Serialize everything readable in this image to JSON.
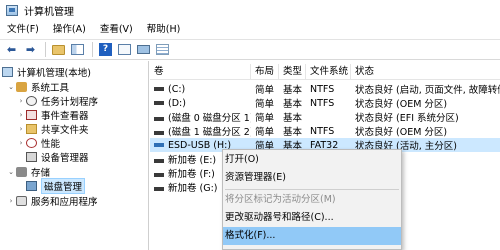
{
  "window": {
    "title": "计算机管理",
    "icon": "computer-management-icon"
  },
  "menu": [
    "文件(F)",
    "操作(A)",
    "查看(V)",
    "帮助(H)"
  ],
  "toolbar": {
    "icons": [
      "back-arrow-icon",
      "forward-arrow-icon",
      "up-folder-icon",
      "show-hide-tree-icon",
      "help-icon",
      "properties-icon",
      "connect-icon",
      "list-icon"
    ],
    "back_glyph": "⬅",
    "forward_glyph": "➡",
    "help_glyph": "?"
  },
  "tree": {
    "items": [
      {
        "label": "计算机管理(本地)",
        "icon": "computer-icon"
      },
      {
        "label": "系统工具",
        "icon": "tools-icon",
        "expand": "⌄"
      },
      {
        "label": "任务计划程序",
        "icon": "task-scheduler-icon",
        "expand": "›"
      },
      {
        "label": "事件查看器",
        "icon": "event-viewer-icon",
        "expand": "›"
      },
      {
        "label": "共享文件夹",
        "icon": "shared-folder-icon",
        "expand": "›"
      },
      {
        "label": "性能",
        "icon": "performance-icon",
        "expand": "›"
      },
      {
        "label": "设备管理器",
        "icon": "device-manager-icon"
      },
      {
        "label": "存储",
        "icon": "storage-icon",
        "expand": "⌄"
      },
      {
        "label": "磁盘管理",
        "icon": "disk-icon"
      },
      {
        "label": "服务和应用程序",
        "icon": "services-icon",
        "expand": "›"
      }
    ]
  },
  "list": {
    "columns": [
      "卷",
      "布局",
      "类型",
      "文件系统",
      "状态"
    ],
    "rows": [
      {
        "vol": "(C:)",
        "layout": "简单",
        "type": "基本",
        "fs": "NTFS",
        "status": "状态良好 (启动, 页面文件, 故障转储"
      },
      {
        "vol": "(D:)",
        "layout": "简单",
        "type": "基本",
        "fs": "NTFS",
        "status": "状态良好 (OEM 分区)"
      },
      {
        "vol": "(磁盘 0 磁盘分区 1)",
        "layout": "简单",
        "type": "基本",
        "fs": "",
        "status": "状态良好 (EFI 系统分区)"
      },
      {
        "vol": "(磁盘 1 磁盘分区 2)",
        "layout": "简单",
        "type": "基本",
        "fs": "NTFS",
        "status": "状态良好 (OEM 分区)"
      },
      {
        "vol": "ESD-USB (H:)",
        "layout": "简单",
        "type": "基本",
        "fs": "FAT32",
        "status": "状态良好 (活动, 主分区)"
      },
      {
        "vol": "新加卷 (E:)",
        "layout": "",
        "type": "",
        "fs": "",
        "status": "主分区)"
      },
      {
        "vol": "新加卷 (F:)",
        "layout": "",
        "type": "",
        "fs": "",
        "status": "主分区)"
      },
      {
        "vol": "新加卷 (G:)",
        "layout": "",
        "type": "",
        "fs": "",
        "status": "主分区)"
      }
    ]
  },
  "context_menu": {
    "items": [
      {
        "label": "打开(O)",
        "enabled": true
      },
      {
        "label": "资源管理器(E)",
        "enabled": true
      },
      {
        "label": "将分区标记为活动分区(M)",
        "enabled": false
      },
      {
        "label": "更改驱动器号和路径(C)...",
        "enabled": true
      },
      {
        "label": "格式化(F)...",
        "enabled": true,
        "highlighted": true
      }
    ]
  }
}
